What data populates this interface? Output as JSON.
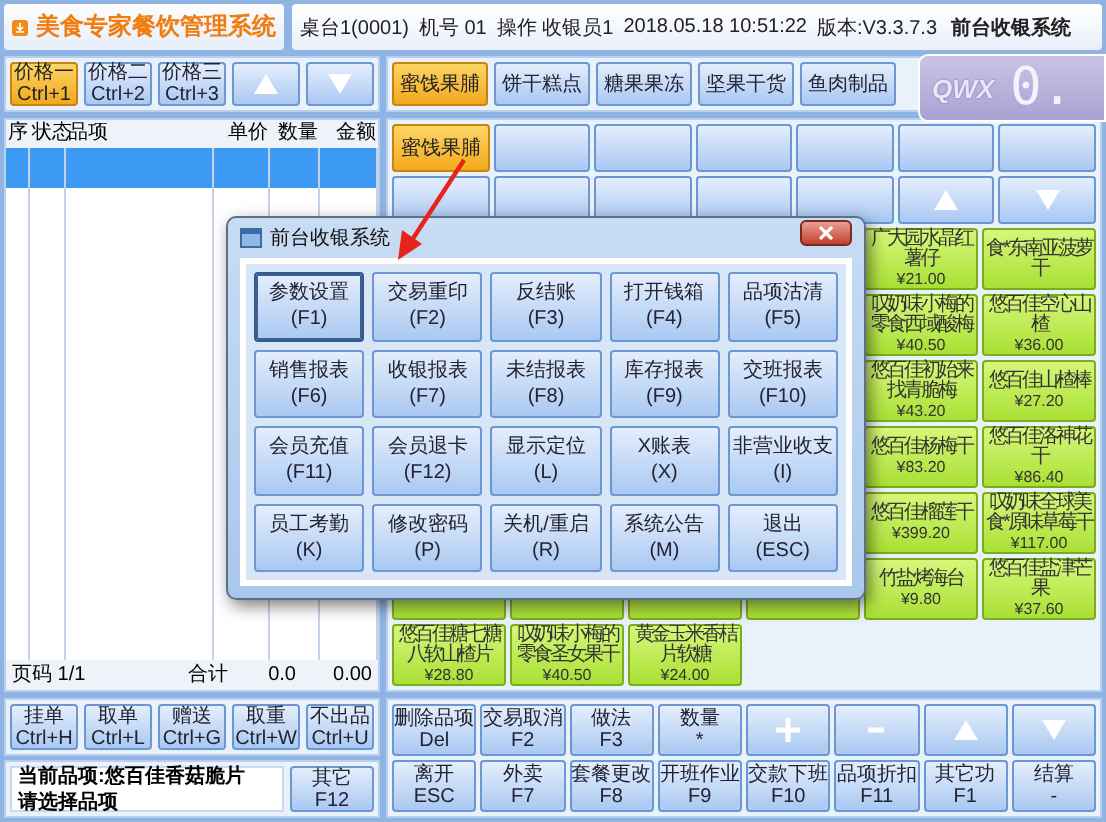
{
  "header": {
    "title": "美食专家餐饮管理系统",
    "info": [
      "桌台1(0001)",
      "机号 01",
      "操作 收银员1",
      "2018.05.18 10:51:22",
      "版本:V3.3.7.3",
      "前台收银系统"
    ]
  },
  "price_buttons": [
    {
      "label": "价格一",
      "shortcut": "Ctrl+1",
      "selected": true
    },
    {
      "label": "价格二",
      "shortcut": "Ctrl+2",
      "selected": false
    },
    {
      "label": "价格三",
      "shortcut": "Ctrl+3",
      "selected": false
    }
  ],
  "order_table": {
    "columns": [
      "序",
      "状态",
      "品项",
      "单价",
      "数量",
      "金额"
    ],
    "rows": [
      {
        "selected": true
      }
    ],
    "footer": {
      "page": "页码 1/1",
      "total_label": "合计",
      "quantity": "0.0",
      "amount": "0.00"
    }
  },
  "order_buttons": [
    {
      "label": "挂单",
      "shortcut": "Ctrl+H"
    },
    {
      "label": "取单",
      "shortcut": "Ctrl+L"
    },
    {
      "label": "赠送",
      "shortcut": "Ctrl+G"
    },
    {
      "label": "取重",
      "shortcut": "Ctrl+W"
    },
    {
      "label": "不出品",
      "shortcut": "Ctrl+U"
    }
  ],
  "current_item": [
    "当前品项:悠百佳香菇脆片",
    "请选择品项"
  ],
  "other_button": {
    "label": "其它",
    "shortcut": "F12"
  },
  "categories": [
    {
      "label": "蜜饯果脯",
      "selected": true
    },
    {
      "label": "饼干糕点",
      "selected": false
    },
    {
      "label": "糖果果冻",
      "selected": false
    },
    {
      "label": "坚果干货",
      "selected": false
    },
    {
      "label": "鱼肉制品",
      "selected": false
    }
  ],
  "display": {
    "logo": "QWX",
    "value": "0."
  },
  "quick_row": [
    {
      "kind": "category",
      "label": "蜜饯果脯"
    },
    {
      "kind": "blank"
    },
    {
      "kind": "blank"
    },
    {
      "kind": "blank"
    },
    {
      "kind": "blank"
    },
    {
      "kind": "blank"
    },
    {
      "kind": "blank"
    }
  ],
  "nav_row": [
    {
      "kind": "blank"
    },
    {
      "kind": "blank"
    },
    {
      "kind": "blank"
    },
    {
      "kind": "blank"
    },
    {
      "kind": "blank"
    },
    {
      "kind": "up"
    },
    {
      "kind": "down"
    }
  ],
  "products": [
    {
      "kind": "blank"
    },
    {
      "kind": "blank"
    },
    {
      "kind": "blank"
    },
    {
      "kind": "blank"
    },
    {
      "kind": "product",
      "name": "广大园水晶红薯仔",
      "price": "¥21.00"
    },
    {
      "kind": "product",
      "name": "食*东南亚菠萝干"
    },
    {
      "kind": "blank"
    },
    {
      "kind": "blank"
    },
    {
      "kind": "blank"
    },
    {
      "kind": "blank"
    },
    {
      "kind": "product",
      "name": "叹奶味小梅的零食西域酸梅",
      "price": "¥40.50"
    },
    {
      "kind": "product",
      "name": "悠百佳空心山楂",
      "price": "¥36.00"
    },
    {
      "kind": "blank"
    },
    {
      "kind": "blank"
    },
    {
      "kind": "blank"
    },
    {
      "kind": "blank"
    },
    {
      "kind": "product",
      "name": "悠百佳初始来找青脆梅",
      "price": "¥43.20"
    },
    {
      "kind": "product",
      "name": "悠百佳山楂棒",
      "price": "¥27.20"
    },
    {
      "kind": "blank"
    },
    {
      "kind": "blank"
    },
    {
      "kind": "blank"
    },
    {
      "kind": "blank"
    },
    {
      "kind": "product",
      "name": "悠百佳杨梅干",
      "price": "¥83.20"
    },
    {
      "kind": "product",
      "name": "悠百佳洛神花干",
      "price": "¥86.40"
    },
    {
      "kind": "blank"
    },
    {
      "kind": "blank"
    },
    {
      "kind": "blank"
    },
    {
      "kind": "blank"
    },
    {
      "kind": "product",
      "name": "悠百佳榴莲干",
      "price": "¥399.20"
    },
    {
      "kind": "product",
      "name": "叹奶味全球美食*原味草莓干",
      "price": "¥117.00"
    },
    {
      "kind": "blank"
    },
    {
      "kind": "blank"
    },
    {
      "kind": "blank"
    },
    {
      "kind": "blank"
    },
    {
      "kind": "product",
      "name": "竹盐烤海台",
      "price": "¥9.80"
    },
    {
      "kind": "product",
      "name": "悠百佳盐津芒果",
      "price": "¥37.60"
    },
    {
      "kind": "product",
      "name": "悠百佳糖七糖八软山楂片",
      "price": "¥28.80"
    },
    {
      "kind": "product",
      "name": "叹奶味小梅的零食圣女果干",
      "price": "¥40.50"
    },
    {
      "kind": "product",
      "name": "黄金玉米香桔片软糖",
      "price": "¥24.00"
    },
    {
      "kind": "empty"
    },
    {
      "kind": "empty"
    },
    {
      "kind": "empty"
    }
  ],
  "function_buttons": [
    {
      "kind": "text",
      "label": "删除品项",
      "shortcut": "Del"
    },
    {
      "kind": "text",
      "label": "交易取消",
      "shortcut": "F2"
    },
    {
      "kind": "text",
      "label": "做法",
      "shortcut": "F3"
    },
    {
      "kind": "text",
      "label": "数量",
      "shortcut": "*"
    },
    {
      "kind": "plus"
    },
    {
      "kind": "minus"
    },
    {
      "kind": "up"
    },
    {
      "kind": "down"
    },
    {
      "kind": "text",
      "label": "离开",
      "shortcut": "ESC"
    },
    {
      "kind": "text",
      "label": "外卖",
      "shortcut": "F7"
    },
    {
      "kind": "text",
      "label": "套餐更改",
      "shortcut": "F8"
    },
    {
      "kind": "text",
      "label": "开班作业",
      "shortcut": "F9"
    },
    {
      "kind": "text",
      "label": "交款下班",
      "shortcut": "F10"
    },
    {
      "kind": "text",
      "label": "品项折扣",
      "shortcut": "F11"
    },
    {
      "kind": "text",
      "label": "其它功",
      "shortcut": "F1"
    },
    {
      "kind": "text",
      "label": "结算",
      "shortcut": "-"
    }
  ],
  "dialog": {
    "title": "前台收银系统",
    "buttons": [
      {
        "label": "参数设置",
        "shortcut": "(F1)",
        "selected": true
      },
      {
        "label": "交易重印",
        "shortcut": "(F2)",
        "selected": false
      },
      {
        "label": "反结账",
        "shortcut": "(F3)",
        "selected": false
      },
      {
        "label": "打开钱箱",
        "shortcut": "(F4)",
        "selected": false
      },
      {
        "label": "品项沽清",
        "shortcut": "(F5)",
        "selected": false
      },
      {
        "label": "销售报表",
        "shortcut": "(F6)",
        "selected": false
      },
      {
        "label": "收银报表",
        "shortcut": "(F7)",
        "selected": false
      },
      {
        "label": "未结报表",
        "shortcut": "(F8)",
        "selected": false
      },
      {
        "label": "库存报表",
        "shortcut": "(F9)",
        "selected": false
      },
      {
        "label": "交班报表",
        "shortcut": "(F10)",
        "selected": false
      },
      {
        "label": "会员充值",
        "shortcut": "(F11)",
        "selected": false
      },
      {
        "label": "会员退卡",
        "shortcut": "(F12)",
        "selected": false
      },
      {
        "label": "显示定位",
        "shortcut": "(L)",
        "selected": false
      },
      {
        "label": "X账表",
        "shortcut": "(X)",
        "selected": false
      },
      {
        "label": "非营业收支",
        "shortcut": "(I)",
        "selected": false
      },
      {
        "label": "员工考勤",
        "shortcut": "(K)",
        "selected": false
      },
      {
        "label": "修改密码",
        "shortcut": "(P)",
        "selected": false
      },
      {
        "label": "关机/重启",
        "shortcut": "(R)",
        "selected": false
      },
      {
        "label": "系统公告",
        "shortcut": "(M)",
        "selected": false
      },
      {
        "label": "退出",
        "shortcut": "(ESC)",
        "selected": false
      }
    ]
  }
}
